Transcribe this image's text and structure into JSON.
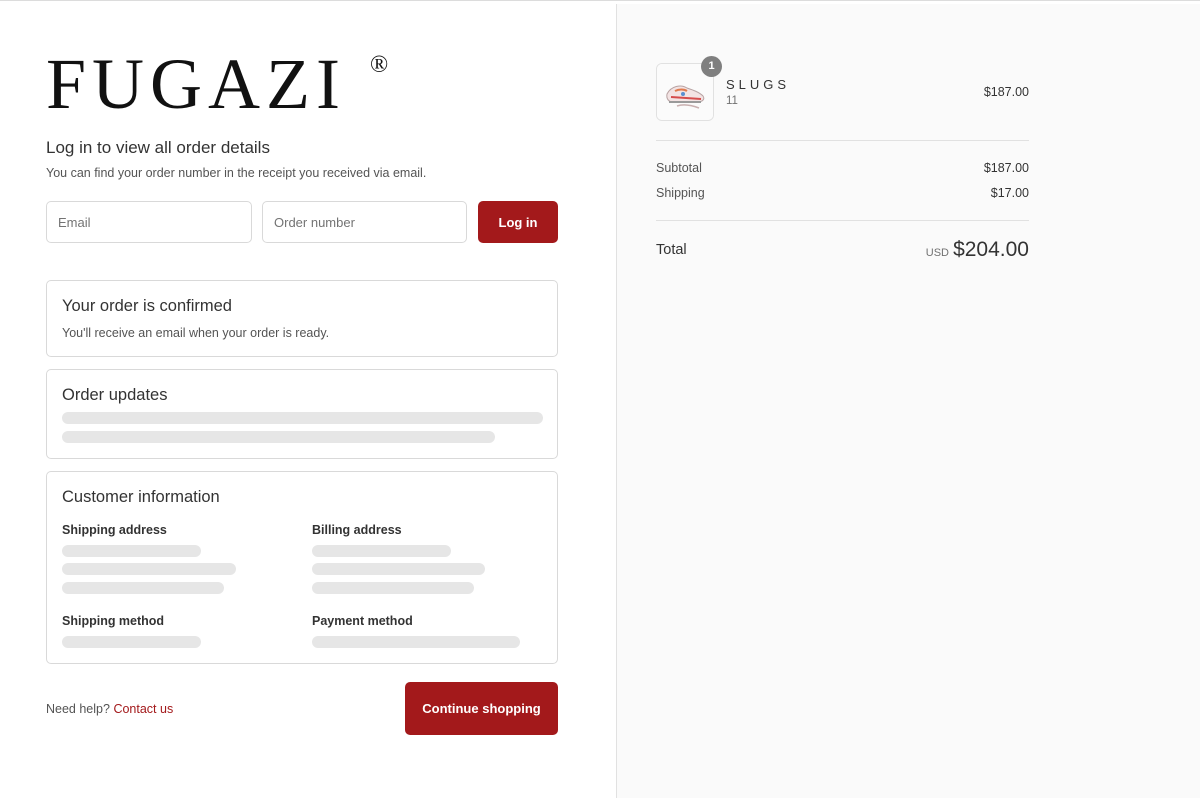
{
  "brand": {
    "logo_text": "FUGAZI",
    "logo_mark": "®"
  },
  "login": {
    "title": "Log in to view all order details",
    "subtitle": "You can find your order number in the receipt you received via email.",
    "email_placeholder": "Email",
    "order_placeholder": "Order number",
    "button_label": "Log in"
  },
  "confirmation": {
    "title": "Your order is confirmed",
    "text": "You'll receive an email when your order is ready."
  },
  "updates": {
    "title": "Order updates"
  },
  "customer": {
    "title": "Customer information",
    "shipping_address_label": "Shipping address",
    "billing_address_label": "Billing address",
    "shipping_method_label": "Shipping method",
    "payment_method_label": "Payment method"
  },
  "footer": {
    "help_text": "Need help?",
    "contact_label": "Contact us",
    "continue_label": "Continue shopping"
  },
  "summary": {
    "item": {
      "name": "SLUGS",
      "variant": "11",
      "price": "$187.00",
      "quantity": "1"
    },
    "subtotal_label": "Subtotal",
    "subtotal_value": "$187.00",
    "shipping_label": "Shipping",
    "shipping_value": "$17.00",
    "total_label": "Total",
    "currency": "USD",
    "total_value": "$204.00"
  },
  "colors": {
    "accent": "#a3191b",
    "summary_bg": "#fafafa",
    "skeleton": "#e6e6e6"
  }
}
